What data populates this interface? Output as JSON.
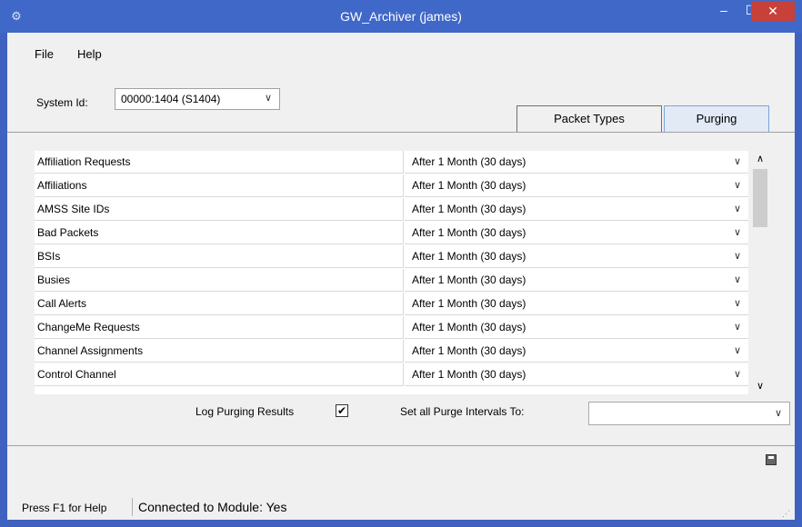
{
  "window": {
    "title": "GW_Archiver (james)",
    "minimize_glyph": "–",
    "maximize_glyph": "☐",
    "close_glyph": "✕"
  },
  "menu": {
    "file": "File",
    "help": "Help"
  },
  "system": {
    "label": "System Id:",
    "value": "00000:1404 (S1404)"
  },
  "tabs": {
    "packet_types": "Packet Types",
    "purging": "Purging"
  },
  "rows": [
    {
      "name": "Affiliation Requests",
      "interval": "After 1 Month (30 days)"
    },
    {
      "name": "Affiliations",
      "interval": "After 1 Month (30 days)"
    },
    {
      "name": "AMSS Site IDs",
      "interval": "After 1 Month (30 days)"
    },
    {
      "name": "Bad Packets",
      "interval": "After 1 Month (30 days)"
    },
    {
      "name": "BSIs",
      "interval": "After 1 Month (30 days)"
    },
    {
      "name": "Busies",
      "interval": "After 1 Month (30 days)"
    },
    {
      "name": "Call Alerts",
      "interval": "After 1 Month (30 days)"
    },
    {
      "name": "ChangeMe Requests",
      "interval": "After 1 Month (30 days)"
    },
    {
      "name": "Channel Assignments",
      "interval": "After 1 Month (30 days)"
    },
    {
      "name": "Control Channel",
      "interval": "After 1 Month (30 days)"
    }
  ],
  "options": {
    "log_label": "Log Purging Results",
    "log_checked": "✔",
    "set_all_label": "Set all Purge Intervals To:",
    "set_all_value": ""
  },
  "status": {
    "help": "Press F1 for Help",
    "connection": "Connected to Module: Yes"
  },
  "icons": {
    "app": "gear-icon",
    "save": "save-icon"
  },
  "colors": {
    "titlebar": "#4068c8",
    "close": "#c7413a"
  }
}
